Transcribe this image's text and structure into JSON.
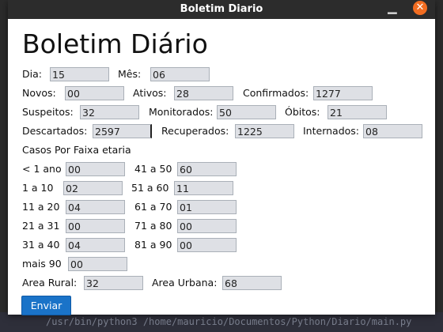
{
  "window": {
    "title": "Boletim Diario"
  },
  "form": {
    "heading": "Boletim Diário",
    "dia": {
      "label": "Dia:",
      "value": "15"
    },
    "mes": {
      "label": "Mês:",
      "value": "06"
    },
    "novos": {
      "label": "Novos:",
      "value": "00"
    },
    "ativos": {
      "label": "Ativos:",
      "value": "28"
    },
    "confirmados": {
      "label": "Confirmados:",
      "value": "1277"
    },
    "suspeitos": {
      "label": "Suspeitos:",
      "value": "32"
    },
    "monitorados": {
      "label": "Monitorados:",
      "value": "50"
    },
    "obitos": {
      "label": "Óbitos:",
      "value": "21"
    },
    "descartados": {
      "label": "Descartados:",
      "value": "2597"
    },
    "recuperados": {
      "label": "Recuperados:",
      "value": "1225"
    },
    "internados": {
      "label": "Internados:",
      "value": "08"
    },
    "faixa_heading": "Casos Por Faixa etaria",
    "faixas": [
      {
        "label": "< 1 ano",
        "value": "00"
      },
      {
        "label": "41 a 50",
        "value": "60"
      },
      {
        "label": "1 a 10",
        "value": "02"
      },
      {
        "label": "51 a 60",
        "value": "11"
      },
      {
        "label": "11 a 20",
        "value": "04"
      },
      {
        "label": "61 a 70",
        "value": "01"
      },
      {
        "label": "21 a 31",
        "value": "00"
      },
      {
        "label": "71 a 80",
        "value": "00"
      },
      {
        "label": "31 a 40",
        "value": "04"
      },
      {
        "label": "81 a 90",
        "value": "00"
      },
      {
        "label": "mais 90",
        "value": "00"
      }
    ],
    "area_rural": {
      "label": "Area Rural:",
      "value": "32"
    },
    "area_urbana": {
      "label": "Area Urbana:",
      "value": "68"
    },
    "submit_label": "Enviar"
  },
  "terminal": {
    "text": "/usr/bin/python3 /home/mauricio/Documentos/Python/Diario/main.py"
  }
}
